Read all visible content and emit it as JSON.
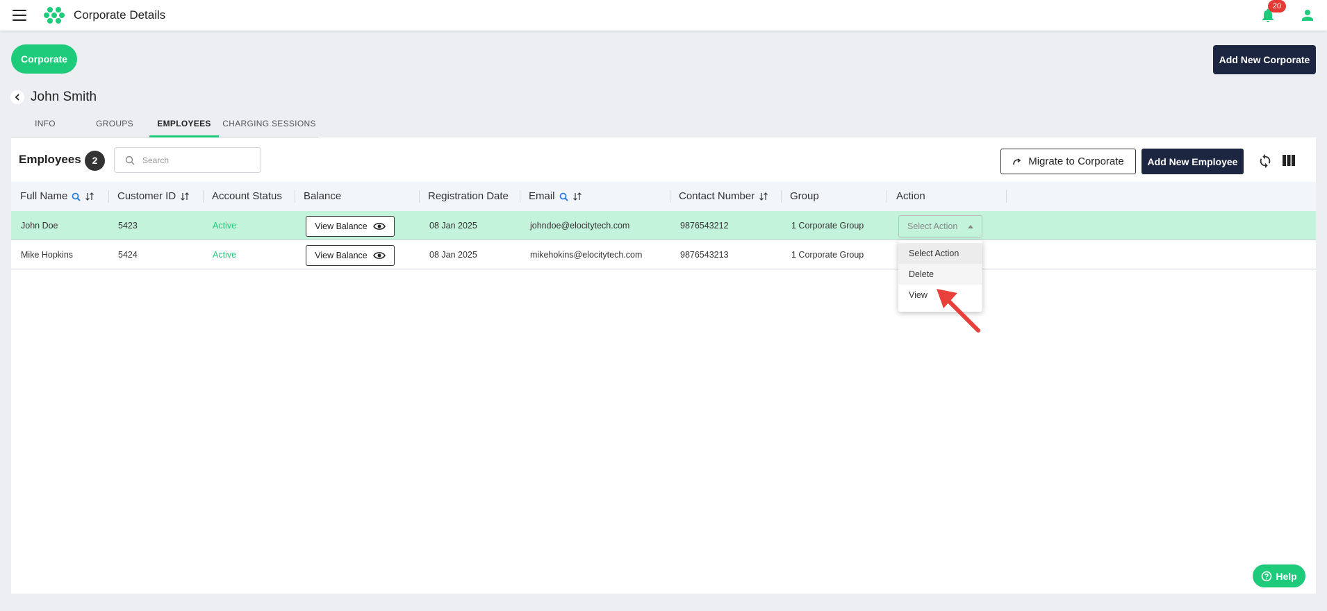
{
  "header": {
    "title": "Corporate Details",
    "notification_count": "20"
  },
  "corporate_pill": "Corporate",
  "add_corporate_label": "Add New Corporate",
  "person": {
    "name": "John Smith"
  },
  "tabs": [
    {
      "label": "INFO"
    },
    {
      "label": "GROUPS"
    },
    {
      "label": "EMPLOYEES"
    },
    {
      "label": "CHARGING SESSIONS"
    }
  ],
  "employees": {
    "title": "Employees",
    "count": "2",
    "search_placeholder": "Search",
    "migrate_label": "Migrate to Corporate",
    "add_label": "Add New Employee"
  },
  "table": {
    "columns": [
      {
        "label": "Full Name"
      },
      {
        "label": "Customer ID"
      },
      {
        "label": "Account Status"
      },
      {
        "label": "Balance"
      },
      {
        "label": "Registration Date"
      },
      {
        "label": "Email"
      },
      {
        "label": "Contact Number"
      },
      {
        "label": "Group"
      },
      {
        "label": "Action"
      }
    ],
    "rows": [
      {
        "name": "John Doe",
        "customer_id": "5423",
        "status": "Active",
        "balance_btn": "View Balance",
        "reg_date": "08 Jan 2025",
        "email": "johndoe@elocitytech.com",
        "contact": "9876543212",
        "group": "1 Corporate Group",
        "action": "Select Action"
      },
      {
        "name": "Mike Hopkins",
        "customer_id": "5424",
        "status": "Active",
        "balance_btn": "View Balance",
        "reg_date": "08 Jan 2025",
        "email": "mikehokins@elocitytech.com",
        "contact": "9876543213",
        "group": "1 Corporate Group",
        "action": ""
      }
    ]
  },
  "action_menu": [
    {
      "label": "Select Action"
    },
    {
      "label": "Delete"
    },
    {
      "label": "View"
    }
  ],
  "help_label": "Help",
  "colors": {
    "accent": "#1ecb7a",
    "navy": "#1d2640",
    "alert": "#e53935",
    "annotation": "#e8413c"
  }
}
